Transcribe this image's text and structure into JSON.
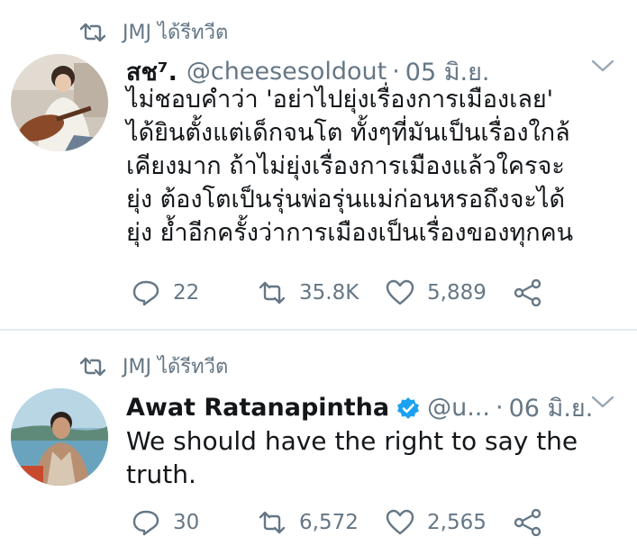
{
  "tweets": [
    {
      "retweeted_by": "JMJ ได้รีทวีต",
      "display_name": "สช⁷.",
      "handle": "@cheesesoldout",
      "separator": "·",
      "date": "05 มิ.ย.",
      "verified": false,
      "text_lines": [
        "ไม่ชอบคำว่า 'อย่าไปยุ่งเรื่องการเมืองเลย'",
        "ได้ยินตั้งแต่เด็กจนโต ทั้งๆที่มันเป็นเรื่องใกล้",
        "เคียงมาก ถ้าไม่ยุ่งเรื่องการเมืองแล้วใครจะ",
        "ยุ่ง ต้องโตเป็นรุ่นพ่อรุ่นแม่ก่อนหรอถึงจะได้",
        "ยุ่ง ย้ำอีกครั้งว่าการเมืองเป็นเรื่องของทุกคน"
      ],
      "replies": "22",
      "retweets": "35.8K",
      "likes": "5,889"
    },
    {
      "retweeted_by": "JMJ ได้รีทวีต",
      "display_name": "Awat Ratanapintha",
      "handle": "@u...",
      "separator": "·",
      "date": "06 มิ.ย.",
      "verified": true,
      "text_lines": [
        "We should have the right to say the",
        "truth."
      ],
      "replies": "30",
      "retweets": "6,572",
      "likes": "2,565"
    }
  ],
  "icons": {
    "retweet": "retweet-icon",
    "reply": "reply-icon",
    "like": "heart-icon",
    "share": "share-icon",
    "caret": "chevron-down-icon",
    "verified": "verified-badge-icon"
  },
  "colors": {
    "text": "#14171a",
    "muted": "#657786",
    "verified": "#1da1f2",
    "divider": "#e6ecf0"
  }
}
